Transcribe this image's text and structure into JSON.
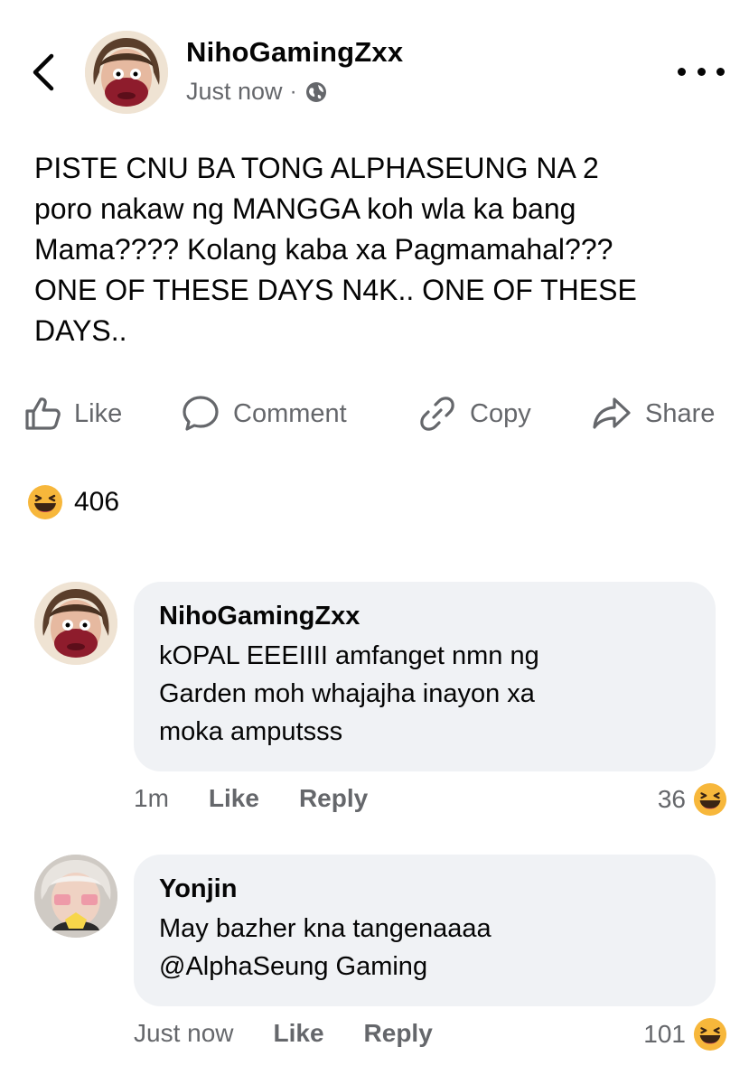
{
  "post": {
    "author": "NihoGamingZxx",
    "timestamp": "Just now",
    "separator": "·",
    "privacy_icon": "globe-icon",
    "text": "PISTE CNU BA TONG ALPHASEUNG NA 2\nporo nakaw ng MANGGA koh wla ka bang\nMama???? Kolang kaba xa Pagmamahal???\nONE OF THESE DAYS N4K.. ONE OF THESE\nDAYS.."
  },
  "actions": {
    "like": "Like",
    "comment": "Comment",
    "copy": "Copy",
    "share": "Share"
  },
  "reactions": {
    "icon": "haha-emoji-icon",
    "count": "406"
  },
  "comments": [
    {
      "author": "NihoGamingZxx",
      "text": "kOPAL EEEIIII amfanget nmn ng\nGarden moh whajajha inayon xa\nmoka amputsss",
      "time": "1m",
      "like_label": "Like",
      "reply_label": "Reply",
      "reaction_count": "36"
    },
    {
      "author": "Yonjin",
      "text": "May bazher kna tangenaaaa\n@AlphaSeung Gaming",
      "time": "Just now",
      "like_label": "Like",
      "reply_label": "Reply",
      "reaction_count": "101"
    }
  ],
  "colors": {
    "text_primary": "#050505",
    "text_secondary": "#65676b",
    "bubble_bg": "#f0f2f5",
    "emoji_yellow": "#f7b73b"
  }
}
